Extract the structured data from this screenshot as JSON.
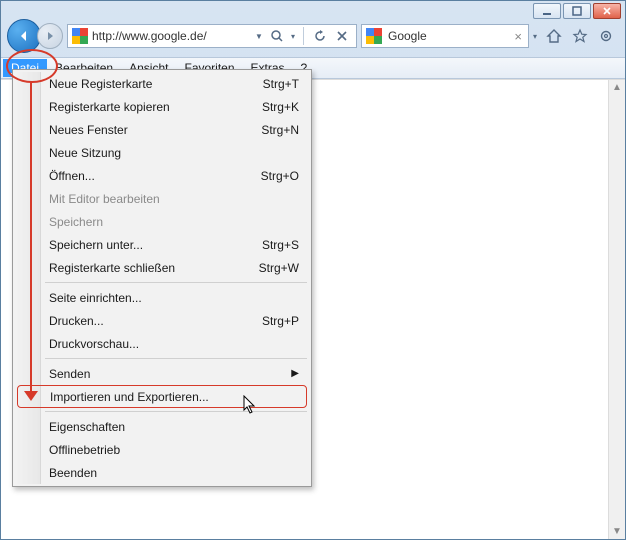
{
  "address_bar": {
    "url": "http://www.google.de/"
  },
  "tab": {
    "title": "Google"
  },
  "menubar": {
    "items": [
      {
        "label": "Datei",
        "mnemonic": "D",
        "active": true
      },
      {
        "label": "Bearbeiten",
        "mnemonic": "B",
        "active": false
      },
      {
        "label": "Ansicht",
        "mnemonic": "A",
        "active": false
      },
      {
        "label": "Favoriten",
        "mnemonic": "F",
        "active": false
      },
      {
        "label": "Extras",
        "mnemonic": "E",
        "active": false
      },
      {
        "label": "?",
        "mnemonic": "?",
        "active": false
      }
    ]
  },
  "dropdown": {
    "items": [
      {
        "type": "item",
        "label": "Neue Registerkarte",
        "shortcut": "Strg+T"
      },
      {
        "type": "item",
        "label": "Registerkarte kopieren",
        "shortcut": "Strg+K"
      },
      {
        "type": "item",
        "label": "Neues Fenster",
        "shortcut": "Strg+N"
      },
      {
        "type": "item",
        "label": "Neue Sitzung",
        "shortcut": ""
      },
      {
        "type": "item",
        "label": "Öffnen...",
        "shortcut": "Strg+O"
      },
      {
        "type": "item",
        "label": "Mit Editor bearbeiten",
        "shortcut": "",
        "disabled": true
      },
      {
        "type": "item",
        "label": "Speichern",
        "shortcut": "",
        "disabled": true
      },
      {
        "type": "item",
        "label": "Speichern unter...",
        "shortcut": "Strg+S"
      },
      {
        "type": "item",
        "label": "Registerkarte schließen",
        "shortcut": "Strg+W"
      },
      {
        "type": "sep"
      },
      {
        "type": "item",
        "label": "Seite einrichten...",
        "shortcut": ""
      },
      {
        "type": "item",
        "label": "Drucken...",
        "shortcut": "Strg+P"
      },
      {
        "type": "item",
        "label": "Druckvorschau...",
        "shortcut": ""
      },
      {
        "type": "sep"
      },
      {
        "type": "item",
        "label": "Senden",
        "shortcut": "",
        "submenu": true
      },
      {
        "type": "item",
        "label": "Importieren und Exportieren...",
        "shortcut": "",
        "highlighted": true
      },
      {
        "type": "sep"
      },
      {
        "type": "item",
        "label": "Eigenschaften",
        "shortcut": ""
      },
      {
        "type": "item",
        "label": "Offlinebetrieb",
        "shortcut": ""
      },
      {
        "type": "item",
        "label": "Beenden",
        "shortcut": ""
      }
    ]
  }
}
